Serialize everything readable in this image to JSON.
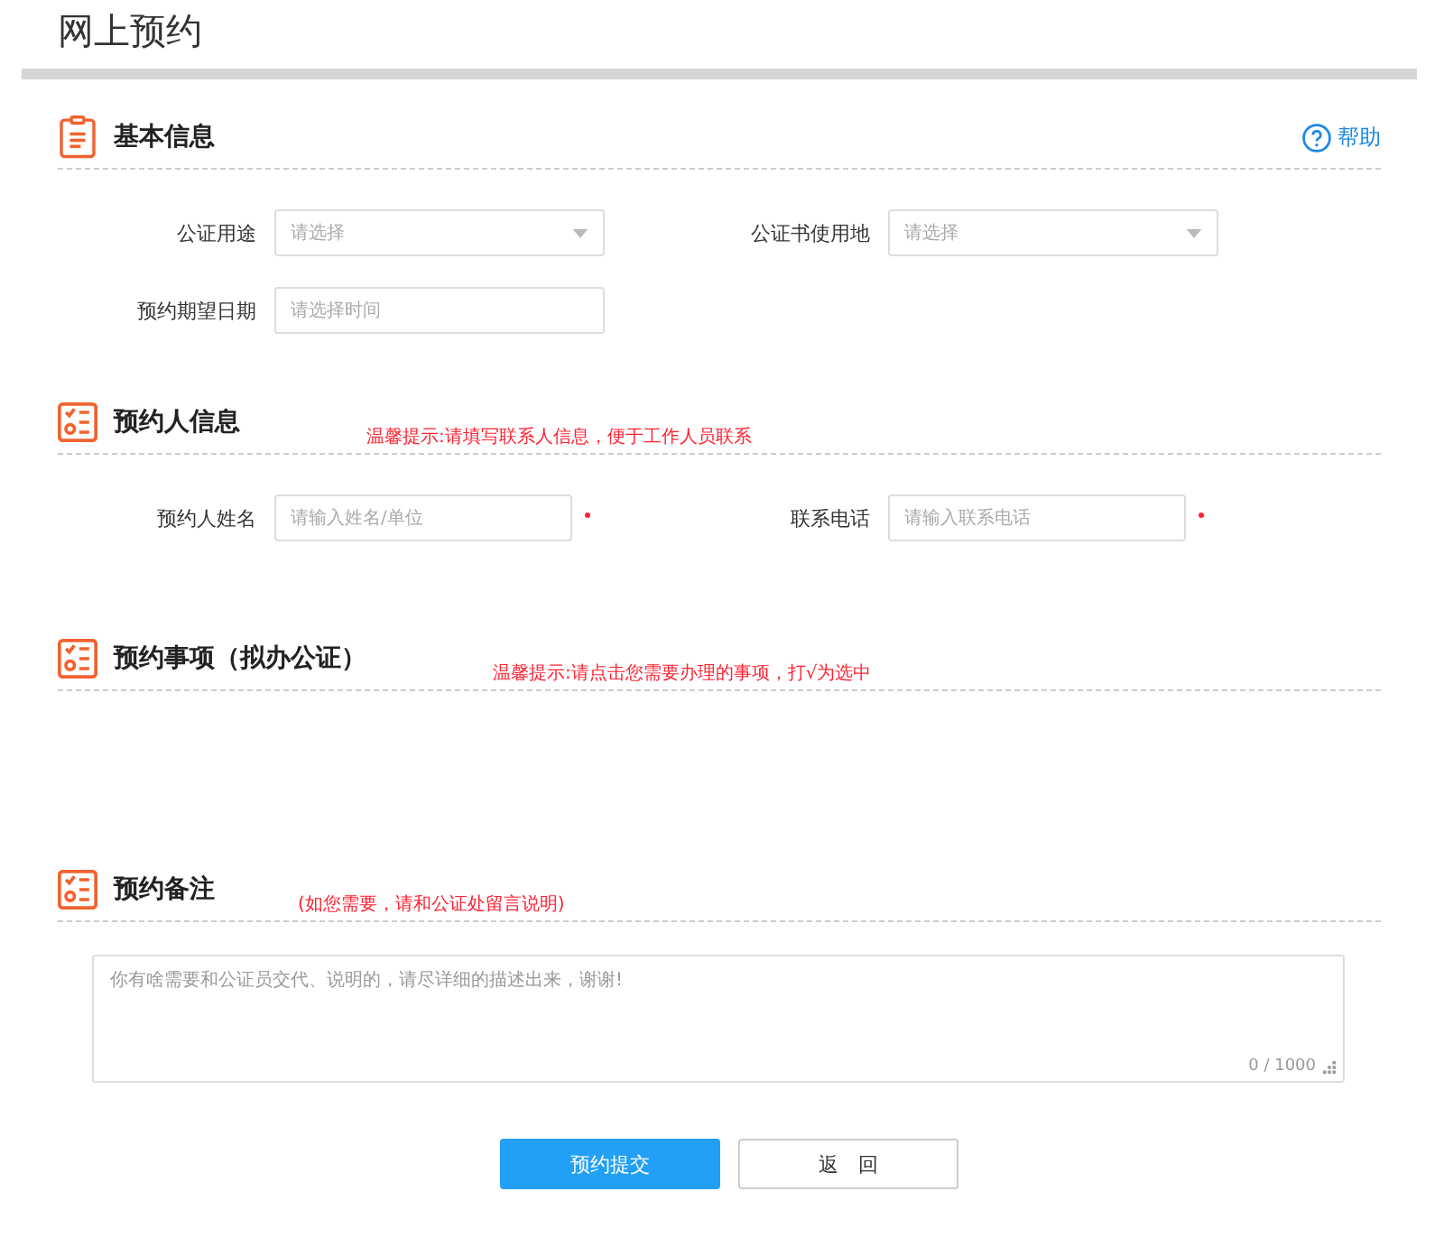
{
  "page_title": "网上预约",
  "sections": [
    {
      "kind": "form",
      "title": "基本信息",
      "help": "帮助",
      "rows": [
        [
          {
            "label": "公证用途",
            "kind": "select",
            "placeholder": "请选择",
            "required": false
          },
          {
            "label": "公证书使用地",
            "kind": "select",
            "placeholder": "请选择",
            "required": false
          }
        ],
        [
          {
            "label": "预约期望日期",
            "kind": "input",
            "placeholder": "请选择时间",
            "required": false
          }
        ]
      ]
    },
    {
      "kind": "form",
      "title": "预约人信息",
      "hint": "温馨提示:请填写联系人信息，便于工作人员联系",
      "rows": [
        [
          {
            "label": "预约人姓名",
            "kind": "input",
            "placeholder": "请输入姓名/单位",
            "required": true
          },
          {
            "label": "联系电话",
            "kind": "input",
            "placeholder": "请输入联系电话",
            "required": true
          }
        ]
      ]
    },
    {
      "kind": "items",
      "title": "预约事项（拟办公证）",
      "hint": "温馨提示:请点击您需要办理的事项，打√为选中"
    },
    {
      "kind": "note",
      "title": "预约备注",
      "hint": "(如您需要，请和公证处留言说明)",
      "placeholder": "你有啥需要和公证员交代、说明的，请尽详细的描述出来，谢谢!",
      "counter": "0 / 1000"
    }
  ],
  "buttons": [
    {
      "label": "预约提交",
      "kind": "primary"
    },
    {
      "label": "返　回",
      "kind": "plain"
    }
  ]
}
